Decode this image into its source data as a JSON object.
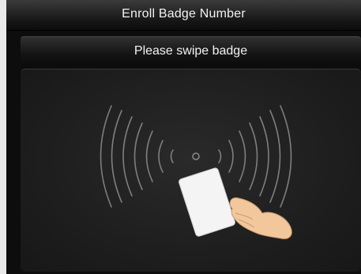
{
  "header": {
    "title": "Enroll Badge Number"
  },
  "prompt": {
    "text": "Please swipe badge"
  },
  "illustration": {
    "icon": "badge-swipe-icon"
  }
}
